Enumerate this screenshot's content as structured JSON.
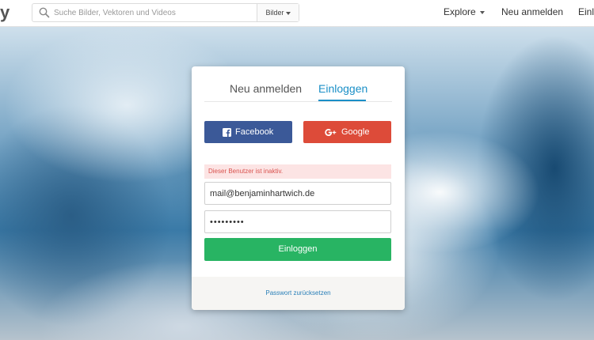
{
  "header": {
    "logo_text": "y",
    "search": {
      "placeholder": "Suche Bilder, Vektoren und Videos",
      "value": "",
      "type_label": "Bilder"
    },
    "nav": {
      "explore": "Explore",
      "register": "Neu anmelden",
      "login": "Einloggen"
    }
  },
  "modal": {
    "tabs": {
      "register": "Neu anmelden",
      "login": "Einloggen",
      "active": "login"
    },
    "social": {
      "facebook": "Facebook",
      "google": "Google"
    },
    "alert": "Dieser Benutzer ist inaktiv.",
    "email_value": "mail@benjaminhartwich.de",
    "password_value": "•••••••••",
    "submit_label": "Einloggen",
    "reset_link": "Passwort zurücksetzen"
  },
  "colors": {
    "facebook": "#3b5998",
    "google": "#dd4b39",
    "submit": "#28b463",
    "accent": "#1a8fc7",
    "alert_bg": "#fce4e4",
    "alert_text": "#d9534f"
  }
}
